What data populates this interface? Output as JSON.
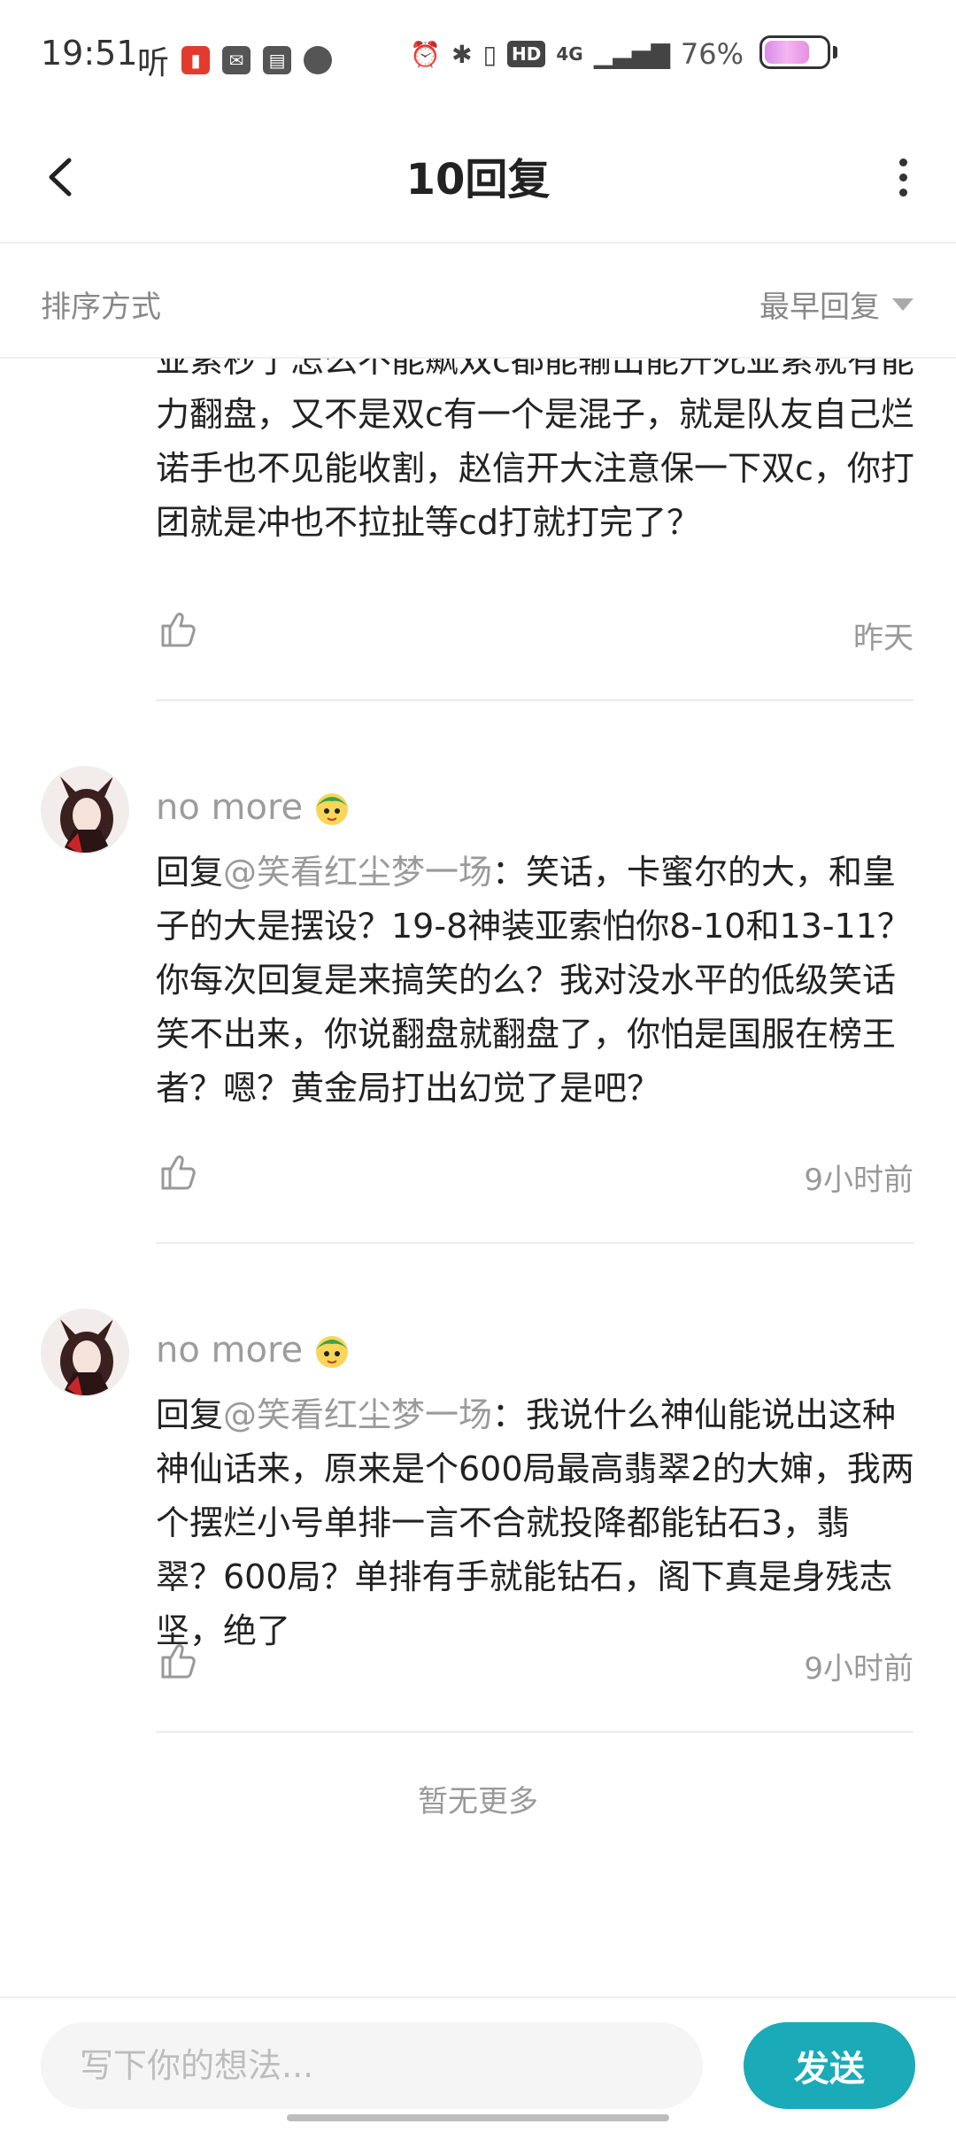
{
  "status_bar": {
    "time": "19:51",
    "ting_label": "听",
    "network": "4G",
    "hd": "HD",
    "battery_text": "76%",
    "battery_level": 0.76
  },
  "header": {
    "title": "10回复"
  },
  "sort": {
    "label": "排序方式",
    "value": "最早回复"
  },
  "comments": [
    {
      "text": "亚索秒了怎么不能飙双c都能输出能开死亚索就有能力翻盘，又不是双c有一个是混子，就是队友自己烂诺手也不见能收割，赵信开大注意保一下双c，你打团就是冲也不拉扯等cd打就打完了？",
      "time": "昨天"
    },
    {
      "username": "no more",
      "reply_prefix": "回复",
      "mention": "@笑看红尘梦一场",
      "text": "：笑话，卡蜜尔的大，和皇子的大是摆设？19-8神装亚索怕你8-10和13-11？你每次回复是来搞笑的么？我对没水平的低级笑话笑不出来，你说翻盘就翻盘了，你怕是国服在榜王者？嗯？黄金局打出幻觉了是吧？",
      "time": "9小时前"
    },
    {
      "username": "no more",
      "reply_prefix": "回复",
      "mention": "@笑看红尘梦一场",
      "text": "：我说什么神仙能说出这种神仙话来，原来是个600局最高翡翠2的大婶，我两个摆烂小号单排一言不合就投降都能钻石3，翡翠？600局？单排有手就能钻石，阁下真是身残志坚，绝了",
      "time": "9小时前"
    }
  ],
  "footer_text": "暂无更多",
  "input": {
    "placeholder": "写下你的想法...",
    "send_label": "发送"
  },
  "colors": {
    "accent": "#1aaab8",
    "muted": "#999999"
  }
}
